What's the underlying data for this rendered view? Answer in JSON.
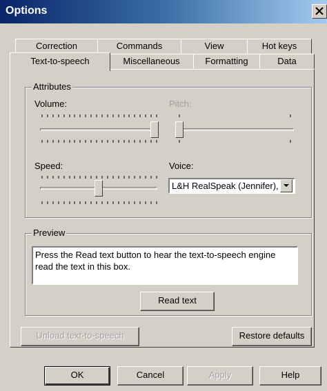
{
  "window": {
    "title": "Options",
    "close_label": "✕"
  },
  "tabs_row1": [
    "Correction",
    "Commands",
    "View",
    "Hot keys"
  ],
  "tabs_row2": [
    "Text-to-speech",
    "Miscellaneous",
    "Formatting",
    "Data"
  ],
  "selected_tab": "Text-to-speech",
  "attributes": {
    "legend": "Attributes",
    "volume_label": "Volume:",
    "volume_level": 1.0,
    "pitch_label": "Pitch:",
    "pitch_level": 0.0,
    "speed_label": "Speed:",
    "speed_level": 0.5,
    "voice_label": "Voice:",
    "voice_value": "L&H RealSpeak (Jennifer), ..."
  },
  "preview": {
    "legend": "Preview",
    "text": "Press the Read text button to hear the text-to-speech engine read the text in this box.",
    "read_button": "Read text"
  },
  "unload_button": "Unload text-to-speech",
  "restore_button": "Restore defaults",
  "footer": {
    "ok": "OK",
    "cancel": "Cancel",
    "apply": "Apply",
    "help": "Help"
  },
  "colors": {
    "face": "#d4d0c8",
    "title_start": "#0a246a",
    "title_end": "#a6caf0",
    "disabled_text": "#a0a0a0"
  }
}
